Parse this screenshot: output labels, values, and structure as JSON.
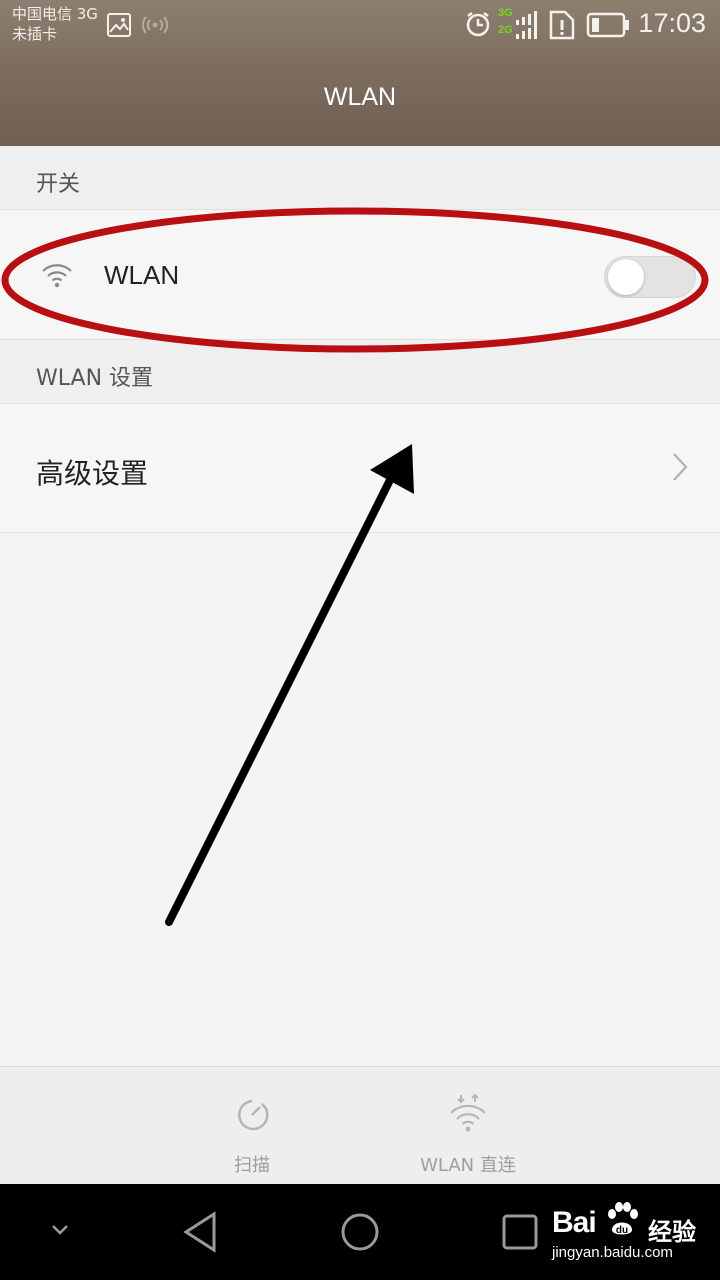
{
  "status_bar": {
    "carrier_line1": "中国电信 3G",
    "carrier_line2": "未插卡",
    "net_top": "3G",
    "net_bottom": "2G",
    "time": "17:03"
  },
  "header": {
    "title": "WLAN"
  },
  "sections": {
    "switch_header": "开关",
    "settings_header": "WLAN 设置"
  },
  "wlan_row": {
    "label": "WLAN",
    "toggle_on": false
  },
  "advanced_row": {
    "label": "高级设置"
  },
  "bottom_actions": {
    "scan_label": "扫描",
    "direct_label": "WLAN 直连"
  },
  "watermark": {
    "brand": "Bai",
    "brand_cn": "经验",
    "url": "jingyan.baidu.com"
  },
  "colors": {
    "header": "#7d6e60",
    "annotation_ellipse": "#b80f12",
    "annotation_arrow": "#000000",
    "toggle_off": "#e4e3e3"
  }
}
